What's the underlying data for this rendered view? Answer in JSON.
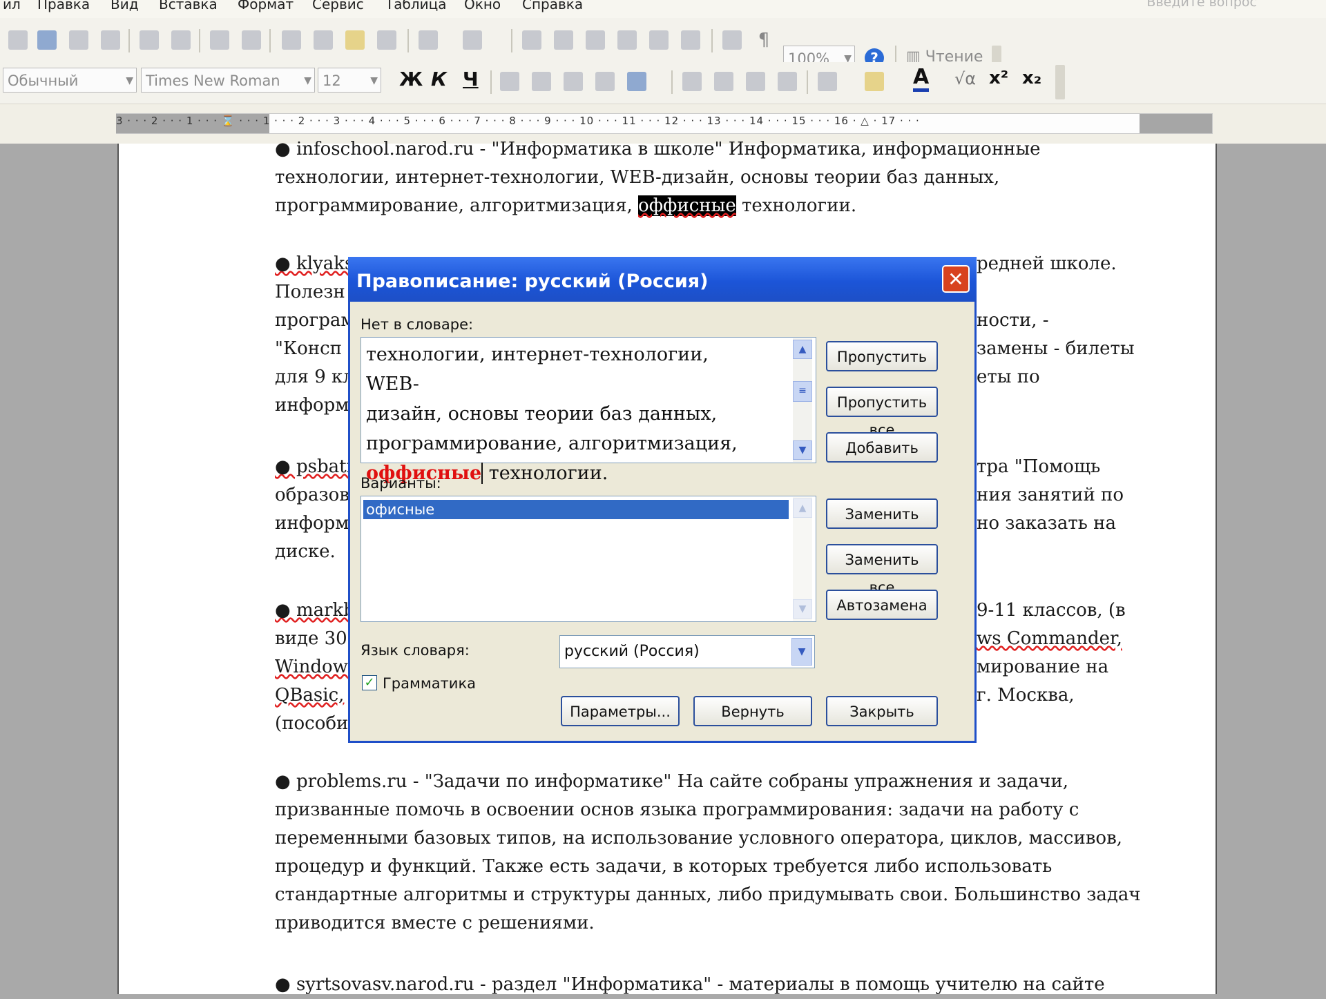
{
  "menu": {
    "items": [
      "ил",
      "Правка",
      "Вид",
      "Вставка",
      "Формат",
      "Сервис",
      "Таблица",
      "Окно",
      "Справка"
    ],
    "question_hint": "Введите вопрос"
  },
  "toolbar": {
    "zoom": "100%",
    "reading_label": "Чтение",
    "style": "Обычный",
    "font": "Times New Roman",
    "size": "12",
    "bold": "Ж",
    "italic": "К",
    "underline": "Ч"
  },
  "ruler": {
    "text": "3 · · · 2 · · · 1 · · · ⌛ · · · 1 · · · 2 · · · 3 · · · 4 · · · 5 · · · 6 · · · 7 · · · 8 · · · 9 · · · 10 · · · 11 · · · 12 · · · 13 · · · 14 · · · 15 · · · 16 · △ · 17 · · ·"
  },
  "document": {
    "p1_l1": "● infoschool.narod.ru - \"Информатика в школе\" Информатика, информационные",
    "p1_l2": "технологии, интернет-технологии, WEB-дизайн, основы теории баз данных,",
    "p1_l3a": "программирование, алгоритмизация, ",
    "p1_l3_sel": "оффисные",
    "p1_l3b": " технологии.",
    "p2_l1a": "● klyaks",
    "p2_l1b": "редней школе.",
    "p2_l2a": "Полезн",
    "p2_l3a": "програм",
    "p2_l3b": "ности, -",
    "p2_l4a": "\"Консп",
    "p2_l4b": "замены - билеты",
    "p2_l5a": "для 9 кл",
    "p2_l5b": "еты по",
    "p2_l6a": "информ",
    "p3_l1a": "● psbati",
    "p3_l1b": "тра \"Помощь",
    "p3_l2a": "образов",
    "p3_l2b": "ния занятий по",
    "p3_l3a": "информ",
    "p3_l3b": "но заказать на",
    "p3_l4a": "диске.",
    "p4_l1a": "● markb",
    "p4_l1b": "9-11 классов, (в",
    "p4_l2a": "виде 30",
    "p4_l2b": "ws Commander,",
    "p4_l3a": "Window",
    "p4_l3b": "мирование на",
    "p4_l4a": "QBasic,",
    "p4_l4b": "г. Москва,",
    "p4_l5a": "(пособи",
    "p5_l1": "● problems.ru - \"Задачи по информатике\" На сайте собраны упражнения и задачи,",
    "p5_l2": "призванные помочь в освоении основ языка программирования: задачи на работу с",
    "p5_l3": "переменными базовых типов, на использование условного оператора, циклов, массивов,",
    "p5_l4": "процедур и функций. Также есть задачи, в которых требуется либо использовать",
    "p5_l5": "стандартные алгоритмы и структуры данных, либо придумывать свои. Большинство задач",
    "p5_l6": "приводится вместе с решениями.",
    "p6_l1": "● syrtsovasv.narod.ru - раздел \"Информатика\" - материалы в помощь учителю на сайте"
  },
  "dialog": {
    "title": "Правописание: русский (Россия)",
    "not_in_dict_label": "Нет в словаре:",
    "context_l1": "технологии, интернет-технологии, WEB-",
    "context_l2": "дизайн, основы теории баз данных,",
    "context_l3": "программирование, алгоритмизация,",
    "context_bad": "оффисные",
    "context_l4_rest": " технологии.",
    "variants_label": "Варианты:",
    "variant_1": "офисные",
    "lang_label": "Язык словаря:",
    "lang_value": "русский (Россия)",
    "grammar_label": "Грамматика",
    "btn_skip": "Пропустить",
    "btn_skip_all": "Пропустить все",
    "btn_add": "Добавить",
    "btn_replace": "Заменить",
    "btn_replace_all": "Заменить все",
    "btn_autocorrect": "Автозамена",
    "btn_params": "Параметры...",
    "btn_undo": "Вернуть",
    "btn_close": "Закрыть"
  }
}
